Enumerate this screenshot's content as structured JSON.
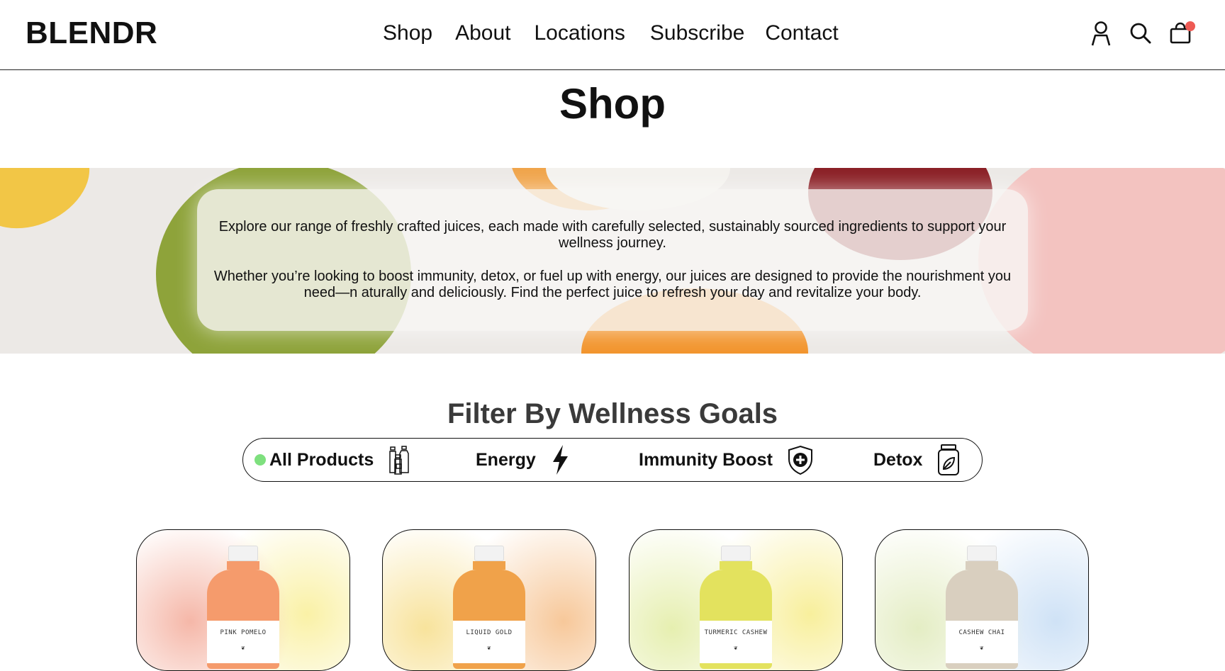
{
  "header": {
    "logo": "BLENDR",
    "nav": [
      "Shop",
      "About",
      "Locations",
      "Subscribe",
      "Contact"
    ],
    "icons": [
      "user-icon",
      "search-icon",
      "cart-icon"
    ],
    "cart_badge_color": "#ee5a54"
  },
  "page": {
    "title": "Shop"
  },
  "hero": {
    "paragraph1": "Explore our range of freshly crafted juices, each made with carefully selected, sustainably sourced ingredients to support your wellness journey.",
    "paragraph2": "Whether you’re looking to boost immunity, detox, or fuel up with energy, our juices are designed to provide the nourishment you need—n aturally and deliciously. Find the perfect juice to refresh your day and revitalize your body."
  },
  "filter": {
    "title": "Filter By Wellness Goals",
    "active_color": "#7ee07e",
    "options": [
      {
        "label": "All Products",
        "icon": "bottles-icon",
        "active": true
      },
      {
        "label": "Energy",
        "icon": "lightning-icon",
        "active": false
      },
      {
        "label": "Immunity Boost",
        "icon": "shield-plus-icon",
        "active": false
      },
      {
        "label": "Detox",
        "icon": "jar-leaf-icon",
        "active": false
      }
    ]
  },
  "products": [
    {
      "name": "PINK POMELO",
      "color": "#f59b6c"
    },
    {
      "name": "LIQUID GOLD",
      "color": "#f0a24a"
    },
    {
      "name": "TURMERIC CASHEW",
      "color": "#e3e25e"
    },
    {
      "name": "CASHEW CHAI",
      "color": "#d9cfbf"
    }
  ]
}
